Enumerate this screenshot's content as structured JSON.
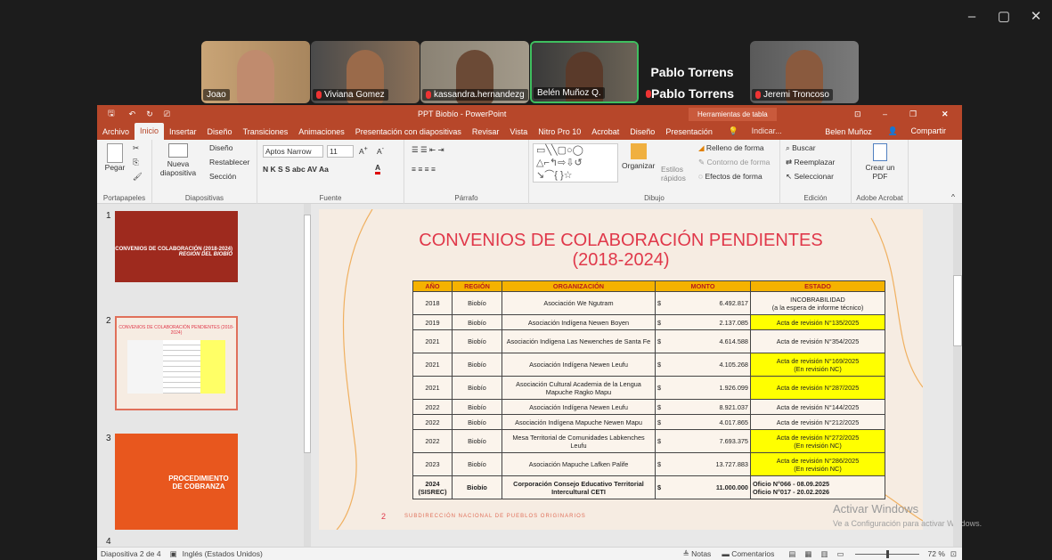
{
  "window_controls": [
    "–",
    "▢",
    "✕"
  ],
  "participants": [
    {
      "name": "Joao",
      "muted": false
    },
    {
      "name": "Viviana Gomez",
      "muted": true
    },
    {
      "name": "kassandra.hernandezg",
      "muted": true
    },
    {
      "name": "Belén Muñoz Q.",
      "muted": false
    },
    {
      "name": "Pablo Torrens",
      "muted": true
    },
    {
      "name": "Jeremi Troncoso",
      "muted": true
    }
  ],
  "speaker_name": "Pablo Torrens",
  "ppt": {
    "title": "PPT Biobío - PowerPoint",
    "context_tab": "Herramientas de tabla",
    "tabs": [
      "Archivo",
      "Inicio",
      "Insertar",
      "Diseño",
      "Transiciones",
      "Animaciones",
      "Presentación con diapositivas",
      "Revisar",
      "Vista",
      "Nitro Pro 10",
      "Acrobat",
      "Diseño",
      "Presentación"
    ],
    "tell_me": "Indicar...",
    "user": "Belen Muñoz",
    "share": "Compartir",
    "ribbon": {
      "paste": "Pegar",
      "new_slide": "Nueva diapositiva",
      "layout": "Diseño",
      "reset": "Restablecer",
      "section": "Sección",
      "font_name": "Aptos Narrow",
      "font_size": "11",
      "fmt": "N K S S abc AV Aa",
      "arrange": "Organizar",
      "styles": "Estilos rápidos",
      "fill": "Relleno de forma",
      "outline": "Contorno de forma",
      "effects": "Efectos de forma",
      "find": "Buscar",
      "replace": "Reemplazar",
      "select": "Seleccionar",
      "pdf": "Crear un PDF",
      "groups": [
        "Portapapeles",
        "Diapositivas",
        "Fuente",
        "Párrafo",
        "Dibujo",
        "Edición",
        "Adobe Acrobat"
      ]
    },
    "thumbs": [
      {
        "num": "1",
        "title": "CONVENIOS DE COLABORACIÓN (2018-2024)",
        "subtitle": "REGIÓN DEL BIOBÍO"
      },
      {
        "num": "2",
        "title": "CONVENIOS DE COLABORACIÓN PENDIENTES (2018-2024)"
      },
      {
        "num": "3",
        "title": "PROCEDIMIENTO DE COBRANZA"
      },
      {
        "num": "4"
      }
    ],
    "slide": {
      "title1": "CONVENIOS DE COLABORACIÓN PENDIENTES",
      "title2": "(2018-2024)",
      "headers": [
        "AÑO",
        "REGIÓN",
        "ORGANIZACIÓN",
        "MONTO",
        "ESTADO"
      ],
      "rows": [
        {
          "y": "2018",
          "r": "Biobío",
          "o": "Asociación We Ngutram",
          "c": "$",
          "m": "6.492.817",
          "e": "INCOBRABILIDAD",
          "e2": "(a la espera de informe técnico)",
          "hl": false
        },
        {
          "y": "2019",
          "r": "Biobío",
          "o": "Asociación Indígena Newen Boyen",
          "c": "$",
          "m": "2.137.085",
          "e": "Acta de revisión N°135/2025",
          "e2": "",
          "hl": true
        },
        {
          "y": "2021",
          "r": "Biobío",
          "o": "Asociación Indígena Las Newenches de Santa Fe",
          "c": "$",
          "m": "4.614.588",
          "e": "Acta de revisión N°354/2025",
          "e2": "",
          "hl": false
        },
        {
          "y": "2021",
          "r": "Biobío",
          "o": "Asociación Indígena Newen Leufu",
          "c": "$",
          "m": "4.105.268",
          "e": "Acta de revisión N°169/2025",
          "e2": "(En revisión NC)",
          "hl": true
        },
        {
          "y": "2021",
          "r": "Biobío",
          "o": "Asociación Cultural Academia de la Lengua Mapuche Ragko Mapu",
          "c": "$",
          "m": "1.926.099",
          "e": "Acta de revisión N°287/2025",
          "e2": "",
          "hl": true
        },
        {
          "y": "2022",
          "r": "Biobío",
          "o": "Asociación Indígena Newen Leufu",
          "c": "$",
          "m": "8.921.037",
          "e": "Acta de revisión N°144/2025",
          "e2": "",
          "hl": false
        },
        {
          "y": "2022",
          "r": "Biobío",
          "o": "Asociación Indígena Mapuche Newen Mapu",
          "c": "$",
          "m": "4.017.865",
          "e": "Acta de revisión N°212/2025",
          "e2": "",
          "hl": false
        },
        {
          "y": "2022",
          "r": "Biobío",
          "o": "Mesa Territorial de Comunidades Labkenches Leufu",
          "c": "$",
          "m": "7.693.375",
          "e": "Acta de revisión N°272/2025",
          "e2": "(En revisión NC)",
          "hl": true
        },
        {
          "y": "2023",
          "r": "Biobío",
          "o": "Asociación Mapuche Lafken Palife",
          "c": "$",
          "m": "13.727.883",
          "e": "Acta de revisión N°286/2025",
          "e2": "(En revisión NC)",
          "hl": true
        },
        {
          "y": "2024 (SISREC)",
          "r": "Biobío",
          "o": "Corporación Consejo Educativo Territorial Intercultural CETI",
          "c": "$",
          "m": "11.000.000",
          "e": "Oficio N°066 - 08.09.2025",
          "e2": "Oficio N°017 - 20.02.2026",
          "hl": false
        }
      ],
      "page_num": "2",
      "footer": "SUBDIRECCIÓN NACIONAL DE PUEBLOS ORIGINARIOS"
    },
    "watermark1": "Activar Windows",
    "watermark2": "Ve a Configuración para activar Windows.",
    "status": {
      "slide": "Diapositiva 2 de 4",
      "lang": "Inglés (Estados Unidos)",
      "notes": "Notas",
      "comments": "Comentarios",
      "zoom": "72 %"
    },
    "colors": {
      "accent": "#b7472a",
      "slide_title": "#e0384a",
      "header_fill": "#f5b200",
      "highlight": "#ffff00"
    }
  }
}
